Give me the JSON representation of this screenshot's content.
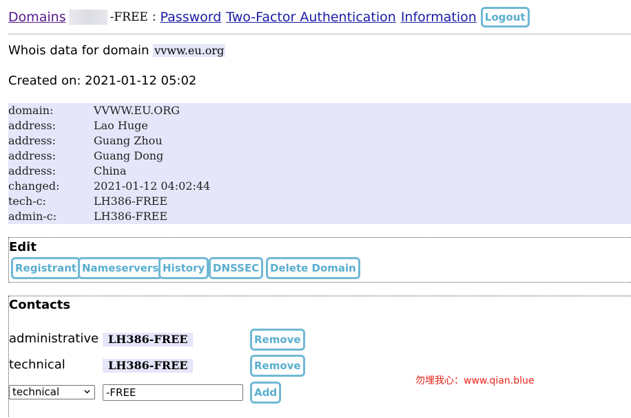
{
  "nav": {
    "domains": "Domains",
    "handle_suffix": "-FREE",
    "separator": ":",
    "password": "Password",
    "two_factor": "Two-Factor Authentication",
    "information": "Information",
    "logout": "Logout"
  },
  "whois": {
    "title_prefix": "Whois data for domain",
    "domain": "vvww.eu.org",
    "created": "Created on: 2021-01-12 05:02",
    "rows": [
      {
        "key": "domain:",
        "value": "VVWW.EU.ORG"
      },
      {
        "key": "address:",
        "value": "Lao Huge"
      },
      {
        "key": "address:",
        "value": "Guang Zhou"
      },
      {
        "key": "address:",
        "value": "Guang Dong"
      },
      {
        "key": "address:",
        "value": "China"
      },
      {
        "key": "changed:",
        "value": "2021-01-12 04:02:44"
      },
      {
        "key": "tech-c:",
        "value": "LH386-FREE"
      },
      {
        "key": "admin-c:",
        "value": "LH386-FREE"
      }
    ]
  },
  "edit": {
    "legend": "Edit",
    "buttons": [
      "Registrant",
      "Nameservers",
      "History",
      "DNSSEC",
      "Delete Domain"
    ]
  },
  "contacts": {
    "legend": "Contacts",
    "rows": [
      {
        "role": "administrative",
        "handle": "LH386-FREE",
        "remove": "Remove"
      },
      {
        "role": "technical",
        "handle": "LH386-FREE",
        "remove": "Remove"
      }
    ],
    "new_role_selected": "technical",
    "new_handle_value": "-FREE",
    "add": "Add"
  },
  "watermark": "勿埋我心：www.qian.blue",
  "colors": {
    "button_border": "#6fb8d4",
    "button_text": "#5aaecf",
    "highlight_bg": "#e6e6fa",
    "link": "#1a1aa6",
    "visited_link": "#551a8b",
    "watermark": "#e8231b"
  }
}
